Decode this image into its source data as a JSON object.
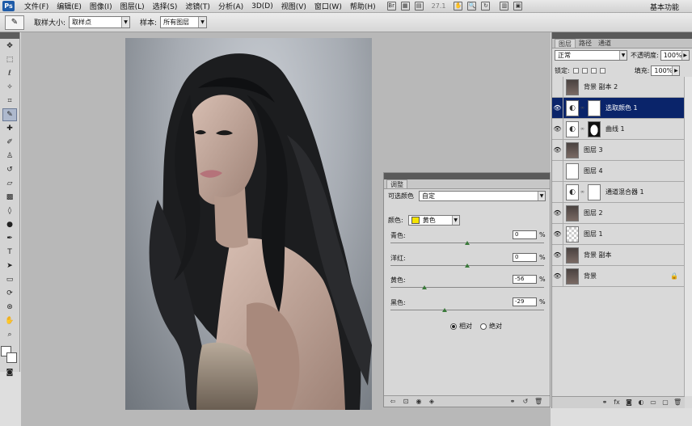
{
  "app": {
    "logo": "Ps",
    "workspace": "基本功能",
    "zoom": "27.1"
  },
  "menu": [
    "文件(F)",
    "编辑(E)",
    "图像(I)",
    "图层(L)",
    "选择(S)",
    "滤镜(T)",
    "分析(A)",
    "3D(D)",
    "视图(V)",
    "窗口(W)",
    "帮助(H)"
  ],
  "options": {
    "sample_size_label": "取样大小:",
    "sample_size_value": "取样点",
    "sample_label": "样本:",
    "sample_value": "所有图层"
  },
  "adjustments": {
    "tab": "调整",
    "preset_label": "可选颜色",
    "preset_value": "自定",
    "colors_label": "颜色:",
    "colors_value": "黄色",
    "swatch_color": "#f5e400",
    "sliders": [
      {
        "label": "青色:",
        "value": "0",
        "pct": "%"
      },
      {
        "label": "洋红:",
        "value": "0",
        "pct": "%"
      },
      {
        "label": "黄色:",
        "value": "-56",
        "pct": "%"
      },
      {
        "label": "黑色:",
        "value": "-29",
        "pct": "%"
      }
    ],
    "slider_levels": [
      0,
      0,
      -56,
      -29
    ],
    "radio_relative": "相对",
    "radio_absolute": "绝对",
    "selected_radio": "relative"
  },
  "layers": {
    "tabs": [
      "图层",
      "路径",
      "通道"
    ],
    "blend_mode": "正常",
    "opacity_label": "不透明度:",
    "opacity": "100%",
    "lock_label": "锁定:",
    "fill_label": "填充:",
    "fill": "100%",
    "items": [
      {
        "name": "背景 副本 2",
        "visible": false,
        "thumb": "photo"
      },
      {
        "name": "选取颜色 1",
        "visible": true,
        "thumb": "adj",
        "mask": "white",
        "selected": true
      },
      {
        "name": "曲线 1",
        "visible": true,
        "thumb": "adj",
        "mask": "shape"
      },
      {
        "name": "图层 3",
        "visible": true,
        "thumb": "photo"
      },
      {
        "name": "图层 4",
        "visible": false,
        "thumb": "white"
      },
      {
        "name": "通道混合器 1",
        "visible": false,
        "thumb": "adj",
        "mask": "white"
      },
      {
        "name": "图层 2",
        "visible": true,
        "thumb": "photo"
      },
      {
        "name": "图层 1",
        "visible": true,
        "thumb": "checker"
      },
      {
        "name": "背景 副本",
        "visible": true,
        "thumb": "photo"
      },
      {
        "name": "背景",
        "visible": true,
        "thumb": "photo",
        "locked": true
      }
    ]
  }
}
